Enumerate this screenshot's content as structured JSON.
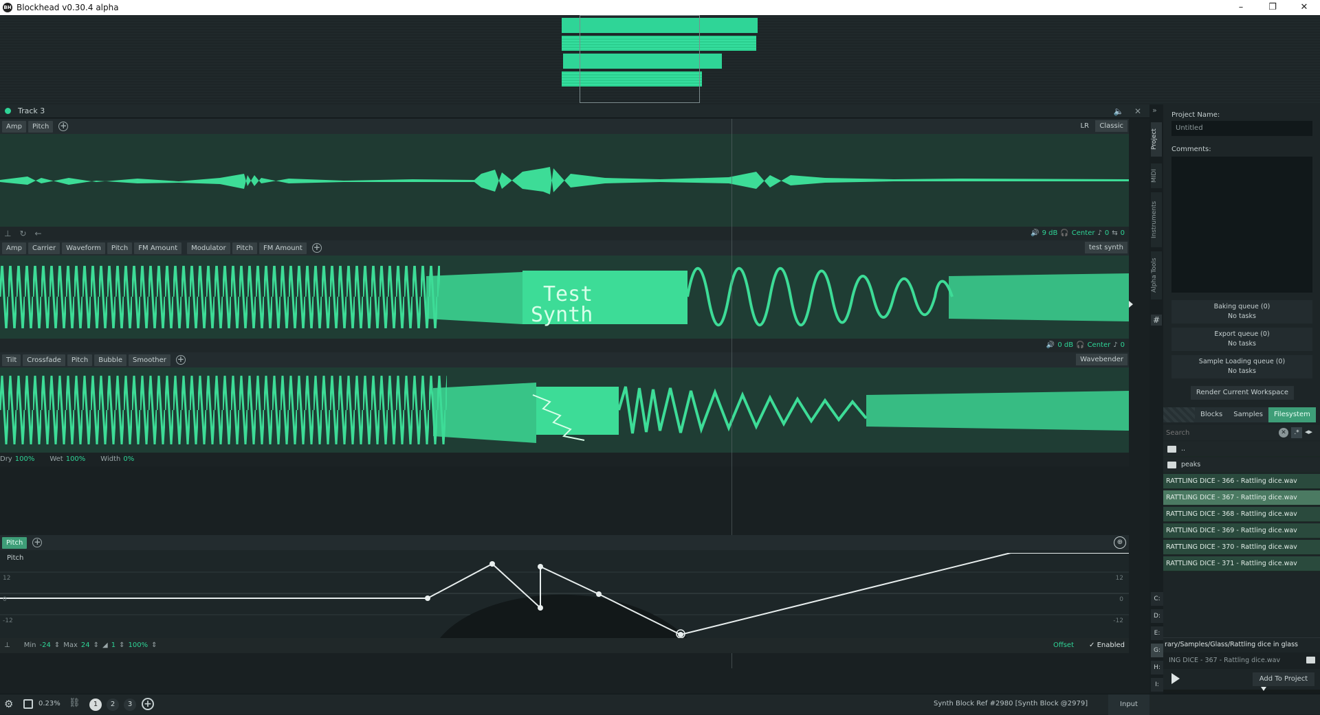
{
  "window": {
    "title": "Blockhead v0.30.4 alpha",
    "app_icon": "BH",
    "minimize": "–",
    "maximize": "❐",
    "close": "✕"
  },
  "track": {
    "name": "Track 3"
  },
  "lane1": {
    "tabs": [
      "Amp",
      "Pitch"
    ],
    "lr": "LR",
    "mode": "Classic",
    "controls": {
      "volume": "9 dB",
      "pan": "Center",
      "pitch": "0",
      "loop": "0"
    }
  },
  "lane2": {
    "tabs": [
      "Amp",
      "Carrier",
      "Waveform",
      "Pitch",
      "FM Amount"
    ],
    "tabs_b": [
      "Modulator",
      "Pitch",
      "FM Amount"
    ],
    "name": "test synth",
    "art_text_1": "Test",
    "art_text_2": "Synth",
    "controls": {
      "volume": "0 dB",
      "pan": "Center",
      "pitch": "0"
    }
  },
  "lane3": {
    "tabs": [
      "Tilt",
      "Crossfade",
      "Pitch",
      "Bubble",
      "Smoother"
    ],
    "name": "Wavebender",
    "dry_label": "Dry",
    "dry": "100%",
    "wet_label": "Wet",
    "wet": "100%",
    "width_label": "Width",
    "width": "0%"
  },
  "pitch_lane": {
    "tab": "Pitch",
    "label": "Pitch",
    "ticks": {
      "top": "12",
      "mid": "0",
      "bottom": "-12"
    },
    "min_label": "Min",
    "min": "-24",
    "max_label": "Max",
    "max": "24",
    "snap": "1",
    "zoom": "100%",
    "offset": "Offset",
    "enabled": "Enabled"
  },
  "status": {
    "cpu": "0.23%",
    "workspaces": [
      "1",
      "2",
      "3"
    ],
    "ref": "Synth Block Ref #2980 [Synth Block @2979]",
    "input": "Input"
  },
  "sidebar_tabs": [
    "Project",
    "MIDI",
    "Instruments",
    "Alpha Tools"
  ],
  "notes": [
    "C:",
    "D:",
    "E:",
    "G:",
    "H:",
    "I:"
  ],
  "project": {
    "name_label": "Project Name:",
    "name_value": "Untitled",
    "comments_label": "Comments:",
    "queues": [
      {
        "title": "Baking queue (0)",
        "status": "No tasks"
      },
      {
        "title": "Export queue (0)",
        "status": "No tasks"
      },
      {
        "title": "Sample Loading queue (0)",
        "status": "No tasks"
      }
    ],
    "render_label": "Render Current Workspace"
  },
  "browser": {
    "tabs": [
      "Blocks",
      "Samples",
      "Filesystem"
    ],
    "search_placeholder": "Search",
    "folders": [
      "..",
      "peaks"
    ],
    "files": [
      "RATTLING DICE - 366 - Rattling dice.wav",
      "RATTLING DICE - 367 - Rattling dice.wav",
      "RATTLING DICE - 368 - Rattling dice.wav",
      "RATTLING DICE - 369 - Rattling dice.wav",
      "RATTLING DICE - 370 - Rattling dice.wav",
      "RATTLING DICE - 371 - Rattling dice.wav"
    ],
    "path": "rary/Samples/Glass/Rattling dice in glass",
    "selected_file": "ING DICE - 367 - Rattling dice.wav",
    "add_label": "Add To Project"
  },
  "colors": {
    "accent": "#2fd597",
    "wave_bg": "#1f3d34",
    "selected": "#4b7a62"
  }
}
